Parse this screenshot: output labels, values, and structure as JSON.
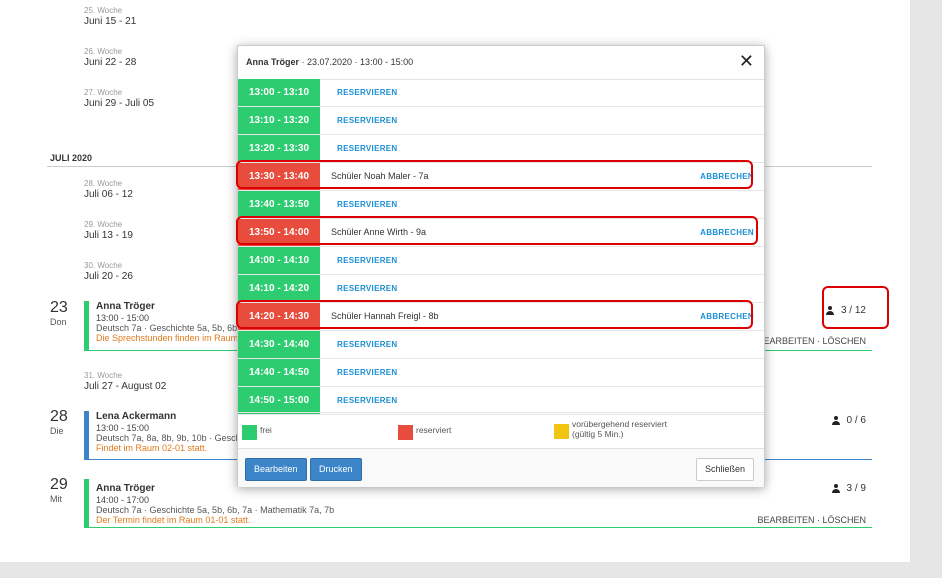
{
  "calendar": {
    "weeks": [
      {
        "label": "25. Woche",
        "range": "Juni 15 - 21"
      },
      {
        "label": "26. Woche",
        "range": "Juni 22 - 28"
      },
      {
        "label": "27. Woche",
        "range": "Juni 29 - Juli 05"
      },
      {
        "label": "28. Woche",
        "range": "Juli 06 - 12"
      },
      {
        "label": "29. Woche",
        "range": "Juli 13 - 19"
      },
      {
        "label": "30. Woche",
        "range": "Juli 20 - 26"
      },
      {
        "label": "31. Woche",
        "range": "Juli 27 - August 02"
      }
    ],
    "month": "JULI 2020",
    "events": [
      {
        "day_num": "23",
        "day_name": "Don",
        "name": "Anna Tröger",
        "time": "13:00 - 15:00",
        "subjects": "Deutsch 7a · Geschichte 5a, 5b, 6b, 7a",
        "note": "Die Sprechstunden finden im Raum 01",
        "count": "3 / 12",
        "edit": "BEARBEITEN",
        "delete": "LÖSCHEN",
        "sep": "·",
        "color": "#2ecc71"
      },
      {
        "day_num": "28",
        "day_name": "Die",
        "name": "Lena Ackermann",
        "time": "13:00 - 15:00",
        "subjects": "Deutsch 7a, 8a, 8b, 9b, 10b · Geschich",
        "note": "Findet im Raum 02-01 statt.",
        "count": "0 / 6",
        "color": "#3c85c8"
      },
      {
        "day_num": "29",
        "day_name": "Mit",
        "name": "Anna Tröger",
        "time": "14:00 - 17:00",
        "subjects": "Deutsch 7a · Geschichte 5a, 5b, 6b, 7a · Mathematik 7a, 7b",
        "note": "Der Termin findet im Raum 01-01 statt.",
        "count": "3 / 9",
        "edit": "BEARBEITEN",
        "delete": "LÖSCHEN",
        "sep": "·",
        "color": "#2ecc71"
      }
    ]
  },
  "modal": {
    "title_name": "Anna Tröger",
    "title_rest": " · 23.07.2020 · 13:00 - 15:00",
    "close": "✕",
    "slots": [
      {
        "time": "13:00 - 13:10",
        "status": "free",
        "action": "RESERVIEREN"
      },
      {
        "time": "13:10 - 13:20",
        "status": "free",
        "action": "RESERVIEREN"
      },
      {
        "time": "13:20 - 13:30",
        "status": "free",
        "action": "RESERVIEREN"
      },
      {
        "time": "13:30 - 13:40",
        "status": "reserved",
        "student": "Schüler Noah Maler - 7a",
        "action": "ABBRECHEN"
      },
      {
        "time": "13:40 - 13:50",
        "status": "free",
        "action": "RESERVIEREN"
      },
      {
        "time": "13:50 - 14:00",
        "status": "reserved",
        "student": "Schüler Anne Wirth - 9a",
        "action": "ABBRECHEN"
      },
      {
        "time": "14:00 - 14:10",
        "status": "free",
        "action": "RESERVIEREN"
      },
      {
        "time": "14:10 - 14:20",
        "status": "free",
        "action": "RESERVIEREN"
      },
      {
        "time": "14:20 - 14:30",
        "status": "reserved",
        "student": "Schüler Hannah Freigl - 8b",
        "action": "ABBRECHEN"
      },
      {
        "time": "14:30 - 14:40",
        "status": "free",
        "action": "RESERVIEREN"
      },
      {
        "time": "14:40 - 14:50",
        "status": "free",
        "action": "RESERVIEREN"
      },
      {
        "time": "14:50 - 15:00",
        "status": "free",
        "action": "RESERVIEREN"
      }
    ],
    "legend": {
      "free": "frei",
      "reserved": "reserviert",
      "temp_line1": "vorübergehend reserviert",
      "temp_line2": "(gültig 5 Min.)"
    },
    "colors": {
      "free": "#2ecc71",
      "reserved": "#e74c3c",
      "temp": "#f1c40f"
    },
    "buttons": {
      "edit": "Bearbeiten",
      "print": "Drucken",
      "close": "Schließen"
    }
  }
}
